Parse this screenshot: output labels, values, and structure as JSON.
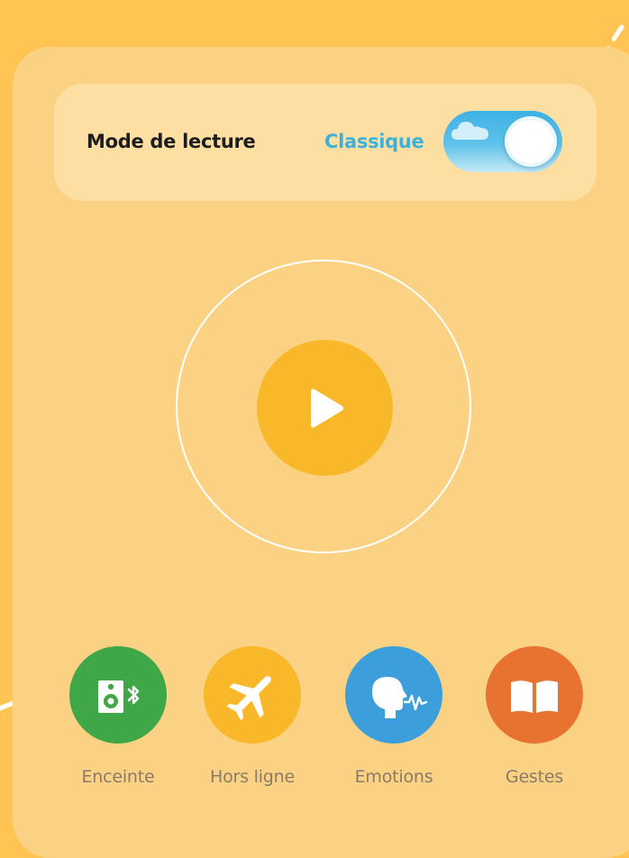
{
  "mode": {
    "title": "Mode de lecture",
    "value": "Classique",
    "toggle_on": true
  },
  "play": {
    "icon": "play-icon"
  },
  "features": [
    {
      "label": "Enceinte",
      "icon": "bluetooth-speaker-icon",
      "color": "#3FA747"
    },
    {
      "label": "Hors ligne",
      "icon": "airplane-icon",
      "color": "#F9B82A"
    },
    {
      "label": "Emotions",
      "icon": "head-voice-icon",
      "color": "#3C9FDC"
    },
    {
      "label": "Gestes",
      "icon": "book-icon",
      "color": "#E8722F"
    }
  ],
  "colors": {
    "background": "#FFC452",
    "panel": "#FBD283",
    "accent_blue": "#3DB1D9",
    "play": "#F9B82A"
  }
}
